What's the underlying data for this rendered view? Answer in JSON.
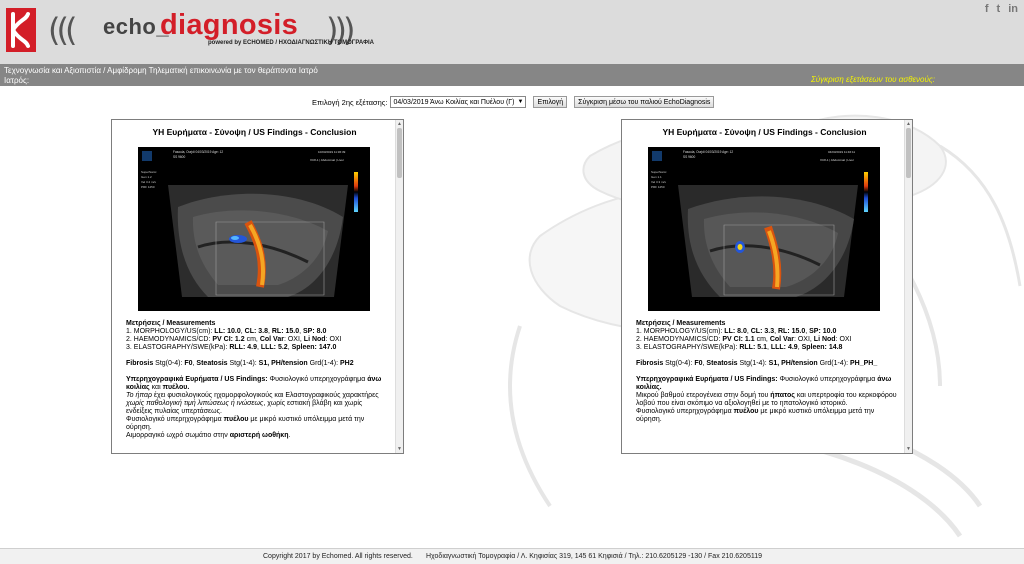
{
  "header": {
    "brand_echo": "echo_",
    "brand_diagnosis": "diagnosis",
    "powered_by": "powered by ECHOMED / ΗΧΟΔΙΑΓΝΩΣΤΙΚΗ ΤΟΜΟΓΡΑΦΙΑ",
    "social": [
      "f",
      "t",
      "in"
    ]
  },
  "strip": {
    "title": "Τεχνογνωσία και Αξιοπιστία / Αμφίδρομη Τηλεματική επικοινωνία με τον θεράποντα Ιατρό",
    "doctor_label": "Ιατρός:",
    "compare_link": "Σύγκριση εξετάσεων του ασθενούς:"
  },
  "selection": {
    "label": "Επιλογή 2ης εξέτασης:",
    "selected": "04/03/2019 Άνω Κοιλίας και Πυέλου (Γ)",
    "select_button": "Επιλογή",
    "compare_button": "Σύγκριση μέσω του παλιού EchoDiagnosis"
  },
  "left_report": {
    "title": "ΥΗ Ευρήματα - Σύνοψη / US Findings - Conclusion",
    "image_header": "Fasoula, Ourjdi 04/03/2019 Age: 12",
    "image_sub": "SS 9600",
    "image_right": "10/03/2019 11:36:39",
    "image_mode": "XC8-1 | Abdominal | Liver",
    "image_params": [
      "SuperSonic",
      "Gen 1.2",
      "Vel 3.2 m/s",
      "PRF 1250"
    ],
    "measurements_heading": "Μετρήσεις / Measurements",
    "m1_prefix": "1. MORPHOLOGY/US(cm): ",
    "m1_a": "LL: 10.0",
    "m1_b": "CL: 3.8",
    "m1_c": "RL: 15.0",
    "m1_d": "SP: 8.0",
    "m2_prefix": "2. HAEMODYNAMICS/CD: ",
    "m2_a": "PV CI: 1.2",
    "m2_a_unit": " cm, ",
    "m2_b": "Col Var",
    "m2_b_val": ": ΟΧΙ, ",
    "m2_c": "Li Nod",
    "m2_c_val": ": ΟΧΙ",
    "m3_prefix": "3. ELASTOGRAPHY/SWE(kPa): ",
    "m3_a": "RLL: 4.9",
    "m3_b": "LLL: 5.2",
    "m3_c": "Spleen: 147.0",
    "fibrosis_label": "Fibrosis",
    "fibrosis_stage": " Stg(0-4): ",
    "fibrosis_val": "F0",
    "steatosis_label": "Steatosis",
    "steatosis_stage": " Stg(1-4): ",
    "steatosis_val": "S1, PH/tension",
    "grade": " Grd(1-4): ",
    "grade_val": "PH2",
    "findings_heading": "Υπερηχογραφικά Ευρήματα / US Findings:",
    "findings_1": " Φυσιολογικό υπερηχογράφημα ",
    "findings_1b": "άνω κοιλίας",
    "findings_1c": " και ",
    "findings_1d": "πυέλου.",
    "findings_2a": "Το ήπαρ",
    "findings_2b": " έχει φυσιολογικούς ηχομορφολογικούς και Ελαστογραφικούς χαρακτήρες ",
    "findings_2c": "χωρίς παθολογική τιμή λιπώσεως ή ινώσεως",
    "findings_2d": ", χωρίς εστιακή βλάβη και χωρίς ενδείξεις πυλαίας υπερτάσεως.",
    "findings_3a": "Φυσιολογικό υπερηχογράφημα ",
    "findings_3b": "πυέλου",
    "findings_3c": " με μικρό κυστικό υπόλειμμα μετά την ούρηση.",
    "findings_4a": "Αιμορραγικό ωχρό σωμάτιο στην ",
    "findings_4b": "αριστερή ωοθήκη",
    "findings_4c": "."
  },
  "right_report": {
    "title": "ΥΗ Ευρήματα - Σύνοψη / US Findings - Conclusion",
    "image_header": "Fasoula, Ourjdi 04/03/2019 Age: 12",
    "image_sub": "SS 9600",
    "image_right": "04/03/2019 11:46:11",
    "image_mode": "XC8-1 | Abdominal | Liver",
    "image_params": [
      "SuperSonic",
      "Gen 1.1",
      "Vel 3.3 m/s",
      "PRF 1250"
    ],
    "measurements_heading": "Μετρήσεις / Measurements",
    "m1_prefix": "1. MORPHOLOGY/US(cm): ",
    "m1_a": "LL: 8.0",
    "m1_b": "CL: 3.3",
    "m1_c": "RL: 15.0",
    "m1_d": "SP: 10.0",
    "m2_prefix": "2. HAEMODYNAMICS/CD: ",
    "m2_a": "PV CI: 1.1",
    "m2_a_unit": " cm, ",
    "m2_b": "Col Var",
    "m2_b_val": ": ΟΧΙ, ",
    "m2_c": "Li Nod",
    "m2_c_val": ": ΟΧΙ",
    "m3_prefix": "3. ELASTOGRAPHY/SWE(kPa): ",
    "m3_a": "RLL: 5.1",
    "m3_b": "LLL: 4.9",
    "m3_c": "Spleen: 14.8",
    "fibrosis_label": "Fibrosis",
    "fibrosis_stage": " Stg(0-4): ",
    "fibrosis_val": "F0",
    "steatosis_label": "Steatosis",
    "steatosis_stage": " Stg(1-4): ",
    "steatosis_val": "S1, PH/tension",
    "grade": " Grd(1-4): ",
    "grade_val": "PH_PH_",
    "findings_heading": "Υπερηχογραφικά Ευρήματα / US Findings:",
    "findings_1": " Φυσιολογικό υπερηχογράφημα ",
    "findings_1b": "άνω κοιλίας.",
    "findings_2a": "Μικρού βαθμού ετερογένεια στην δομή του ",
    "findings_2b": "ήπατος",
    "findings_2c": " και υπερτροφία του κερκοφόρου λοβού που είναι σκόπιμο να αξιολογηθεί με το ηπατολογικό ιστορικό.",
    "findings_3a": "Φυσιολογικό υπερηχογράφημα ",
    "findings_3b": "πυέλου",
    "findings_3c": " με μικρό κυστικό υπόλειμμα μετά την ούρηση."
  },
  "footer": {
    "copyright": "Copyright 2017 by Echomed. All rights reserved.",
    "address": "Ηχοδιαγνωστική Τομογραφία / Λ. Κηφισίας 319, 145 61 Κηφισιά / Τηλ.: 210.6205129 -130 / Fax 210.6205119"
  },
  "colors": {
    "brand_red": "#d31e28",
    "strip_gray": "#868686",
    "compare_yellow": "#f4f400"
  }
}
